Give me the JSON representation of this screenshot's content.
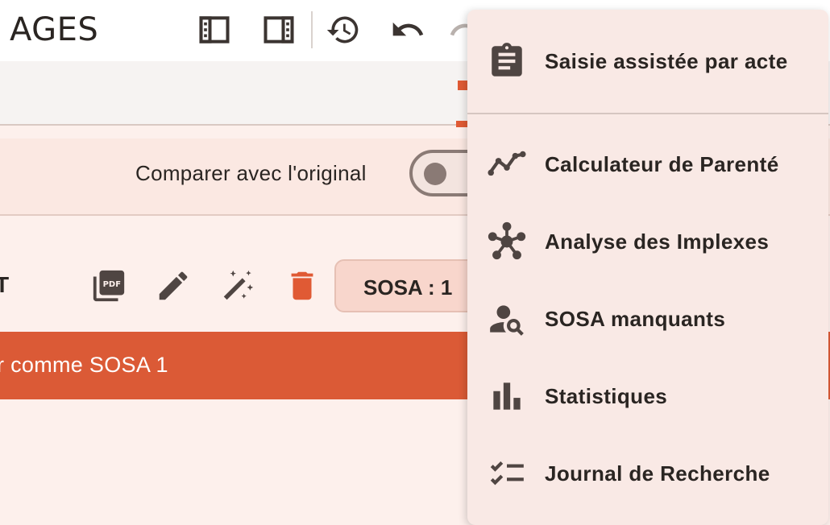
{
  "header": {
    "title": "AGES",
    "icons": [
      "panel-left-icon",
      "panel-right-icon",
      "history-icon",
      "undo-icon",
      "redo-icon"
    ]
  },
  "compare": {
    "label": "Comparer avec l'original",
    "toggle_on": false
  },
  "actions": {
    "row_text": "T",
    "icons": [
      "pdf-icon",
      "pencil-icon",
      "magic-wand-icon",
      "trash-icon"
    ],
    "sosa_chip": "SOSA : 1"
  },
  "banner": {
    "text": "r comme SOSA 1"
  },
  "menu": {
    "items": [
      {
        "label": "Saisie assistée par acte",
        "icon": "clipboard-icon"
      },
      {
        "label": "Calculateur de Parenté",
        "icon": "line-chart-icon"
      },
      {
        "label": "Analyse des Implexes",
        "icon": "hub-network-icon"
      },
      {
        "label": "SOSA manquants",
        "icon": "person-search-icon"
      },
      {
        "label": "Statistiques",
        "icon": "bar-chart-icon"
      },
      {
        "label": "Journal de Recherche",
        "icon": "checklist-icon"
      }
    ]
  },
  "colors": {
    "accent": "#db5a36",
    "delete": "#e05a34",
    "icon": "#4f4542",
    "menu_bg": "#f9e9e5"
  }
}
